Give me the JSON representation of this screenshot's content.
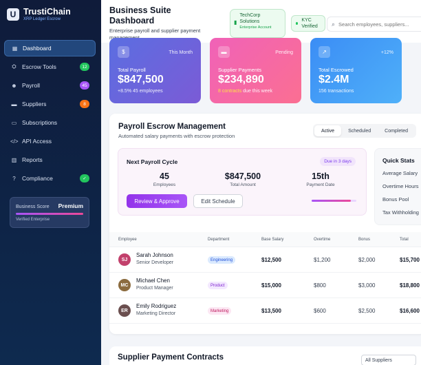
{
  "brand": {
    "logo_letter": "U",
    "title": "TrustiChain",
    "subtitle": "XRP Ledger Escrow"
  },
  "sidebar": {
    "items": [
      {
        "label": "Dashboard",
        "icon": "dashboard-icon",
        "glyph": "▦",
        "active": true
      },
      {
        "label": "Escrow Tools",
        "icon": "handshake-icon",
        "glyph": "⛭",
        "badge": "12",
        "badge_color": "#22c55e"
      },
      {
        "label": "Payroll",
        "icon": "users-icon",
        "glyph": "☻",
        "badge": "45",
        "badge_color": "#a855f7"
      },
      {
        "label": "Suppliers",
        "icon": "truck-icon",
        "glyph": "▬",
        "badge": "8",
        "badge_color": "#f97316"
      },
      {
        "label": "Subscriptions",
        "icon": "card-icon",
        "glyph": "▭"
      },
      {
        "label": "API Access",
        "icon": "code-icon",
        "glyph": "</>"
      },
      {
        "label": "Reports",
        "icon": "chart-icon",
        "glyph": "▥"
      },
      {
        "label": "Compliance",
        "icon": "shield-icon",
        "glyph": "?",
        "badge": "✓",
        "badge_color": "#22c55e"
      }
    ],
    "score": {
      "label": "Business Score",
      "value": "Premium",
      "sub": "Verified Enterprise"
    }
  },
  "header": {
    "title": "Business Suite Dashboard",
    "subtitle": "Enterprise payroll and supplier payment management",
    "org": {
      "name": "TechCorp Solutions",
      "sub": "Enterprise Account"
    },
    "kyc": "KYC Verified",
    "search_placeholder": "Search employees, suppliers..."
  },
  "stats": [
    {
      "label": "Total Payroll",
      "value": "$847,500",
      "tag": "This Month",
      "foot_a": "+8.5%",
      "foot_b": "45 employees",
      "icon": "payroll-icon",
      "glyph": "$",
      "gradient": "linear-gradient(135deg,#5b6ee1,#7b5bd6)"
    },
    {
      "label": "Supplier Payments",
      "value": "$234,890",
      "tag": "Pending",
      "foot_a": "8 contracts",
      "foot_b": "due this week",
      "icon": "truck-icon",
      "glyph": "▬",
      "gradient": "linear-gradient(135deg,#f062b8,#fb6f92)"
    },
    {
      "label": "Total Escrowed",
      "value": "$2.4M",
      "tag": "+12%",
      "foot_a": "",
      "foot_b": "156 transactions",
      "icon": "chart-icon",
      "glyph": "↗",
      "gradient": "linear-gradient(135deg,#3b8df5,#4fb0f9)"
    }
  ],
  "payroll": {
    "title": "Payroll Escrow Management",
    "subtitle": "Automated salary payments with escrow protection",
    "tabs": [
      {
        "label": "Active",
        "active": true
      },
      {
        "label": "Scheduled"
      },
      {
        "label": "Completed"
      }
    ],
    "cycle": {
      "title": "Next Payroll Cycle",
      "due": "Due in 3 days",
      "metrics": [
        {
          "value": "45",
          "label": "Employees"
        },
        {
          "value": "$847,500",
          "label": "Total Amount"
        },
        {
          "value": "15th",
          "label": "Payment Date"
        }
      ],
      "approve_label": "Review & Approve",
      "edit_label": "Edit Schedule",
      "progress": 0.87
    },
    "quick_stats": {
      "title": "Quick Stats",
      "items": [
        "Average Salary",
        "Overtime Hours",
        "Bonus Pool",
        "Tax Withholding"
      ]
    },
    "table": {
      "columns": [
        "Employee",
        "Department",
        "Base Salary",
        "Overtime",
        "Bonus",
        "Total"
      ],
      "rows": [
        {
          "initials": "SJ",
          "avatar_color": "#c2416c",
          "name": "Sarah Johnson",
          "role": "Senior Developer",
          "dept": "Engineering",
          "dept_bg": "#dbeafe",
          "dept_fg": "#1d4ed8",
          "base": "$12,500",
          "overtime": "$1,200",
          "bonus": "$2,000",
          "total": "$15,700"
        },
        {
          "initials": "MC",
          "avatar_color": "#8b6b3e",
          "name": "Michael Chen",
          "role": "Product Manager",
          "dept": "Product",
          "dept_bg": "#f3e8ff",
          "dept_fg": "#7e22ce",
          "base": "$15,000",
          "overtime": "$800",
          "bonus": "$3,000",
          "total": "$18,800"
        },
        {
          "initials": "ER",
          "avatar_color": "#6b4f4f",
          "name": "Emily Rodriguez",
          "role": "Marketing Director",
          "dept": "Marketing",
          "dept_bg": "#fce7f3",
          "dept_fg": "#be185d",
          "base": "$13,500",
          "overtime": "$600",
          "bonus": "$2,500",
          "total": "$16,600"
        }
      ]
    }
  },
  "contracts": {
    "title": "Supplier Payment Contracts",
    "filter": "All Suppliers"
  }
}
